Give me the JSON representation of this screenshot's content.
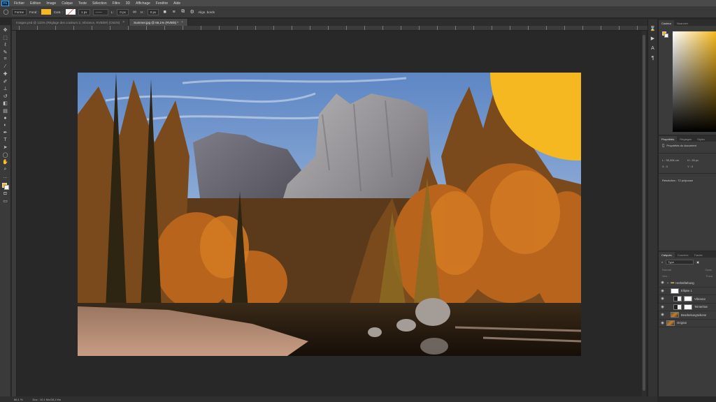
{
  "app": {
    "logo_text": "Ps"
  },
  "menu": [
    "Fichier",
    "Edition",
    "Image",
    "Calque",
    "Texte",
    "Sélection",
    "Filtre",
    "3D",
    "Affichage",
    "Fenêtre",
    "Aide"
  ],
  "options": {
    "mode": "Forme",
    "fill_label": "Fond :",
    "fill_color": "#f5b820",
    "stroke_label": "Cont. :",
    "stroke_width": "1 px",
    "w_label": "L :",
    "w_value": "0 px",
    "h_label": "H :",
    "h_value": "0 px",
    "align_edges": "Align. bords"
  },
  "tabs": [
    {
      "label": "Images.psd @ 133% (Réglage des couleurs 2, Vibrance, RVB/8#) (CMJN)"
    },
    {
      "label": "Summer.jpg @ 66,1% (RVB/8) *",
      "active": true
    }
  ],
  "status": {
    "zoom": "66,1 %",
    "doc": "Doc : 10,1 Mo/28,1 Mo"
  },
  "color_panel": {
    "tab_color": "Couleur",
    "tab_swatches": "Nuancier",
    "accent": "#f5b820"
  },
  "properties": {
    "tabs": [
      "Propriétés",
      "Réglages",
      "Styles"
    ],
    "title": "Propriétés du document",
    "l_label": "L : 35,306 cm",
    "h_label": "H : 28 px",
    "x_label": "X : 0",
    "y_label": "Y : 0",
    "resolution": "Résolution : 72 px/pouce"
  },
  "layers": {
    "tabs": [
      "Calques",
      "Couches",
      "Tracés"
    ],
    "filter": "Type",
    "blend": "Normal",
    "opacity": "Opac.",
    "lock": "Verr. :",
    "fill": "Fond",
    "rows": [
      {
        "name": "Herbstfärbung",
        "kind": "folder",
        "indent": 0
      },
      {
        "name": "Ellipse 1",
        "kind": "shape",
        "indent": 1
      },
      {
        "name": "Vibrance",
        "kind": "adj",
        "indent": 2
      },
      {
        "name": "Teinte/Sat",
        "kind": "adj",
        "indent": 2
      },
      {
        "name": "Bearbeitungsebene",
        "kind": "photo",
        "indent": 1
      },
      {
        "name": "Original",
        "kind": "photo",
        "indent": 0
      }
    ]
  }
}
